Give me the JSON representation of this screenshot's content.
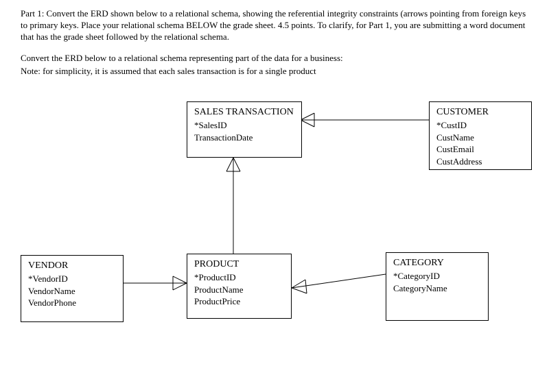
{
  "instructions": {
    "p1": "Part 1: Convert the ERD shown below to a relational schema, showing the referential integrity constraints (arrows pointing from foreign keys to primary keys. Place your relational schema BELOW the grade sheet. 4.5 points. To clarify, for Part 1, you are submitting a word document that has the grade sheet followed by the relational schema.",
    "p2": "Convert the ERD below to a relational schema representing part of the data for a business:",
    "p3": "Note: for simplicity, it is assumed that each sales transaction is for a single product"
  },
  "entities": {
    "sales_transaction": {
      "name": "SALES TRANSACTION",
      "pk": "*SalesID",
      "attrs": [
        "TransactionDate"
      ]
    },
    "customer": {
      "name": "CUSTOMER",
      "pk": "*CustID",
      "attrs": [
        "CustName",
        "CustEmail",
        "CustAddress"
      ]
    },
    "vendor": {
      "name": "VENDOR",
      "pk": "*VendorID",
      "attrs": [
        "VendorName",
        "VendorPhone"
      ]
    },
    "product": {
      "name": "PRODUCT",
      "pk": "*ProductID",
      "attrs": [
        "ProductName",
        "ProductPrice"
      ]
    },
    "category": {
      "name": "CATEGORY",
      "pk": "*CategoryID",
      "attrs": [
        "CategoryName"
      ]
    }
  },
  "relationships": [
    {
      "from": "SALES TRANSACTION",
      "to": "CUSTOMER",
      "type": "many-to-one"
    },
    {
      "from": "SALES TRANSACTION",
      "to": "PRODUCT",
      "type": "many-to-one"
    },
    {
      "from": "PRODUCT",
      "to": "VENDOR",
      "type": "many-to-one"
    },
    {
      "from": "PRODUCT",
      "to": "CATEGORY",
      "type": "many-to-one"
    }
  ]
}
